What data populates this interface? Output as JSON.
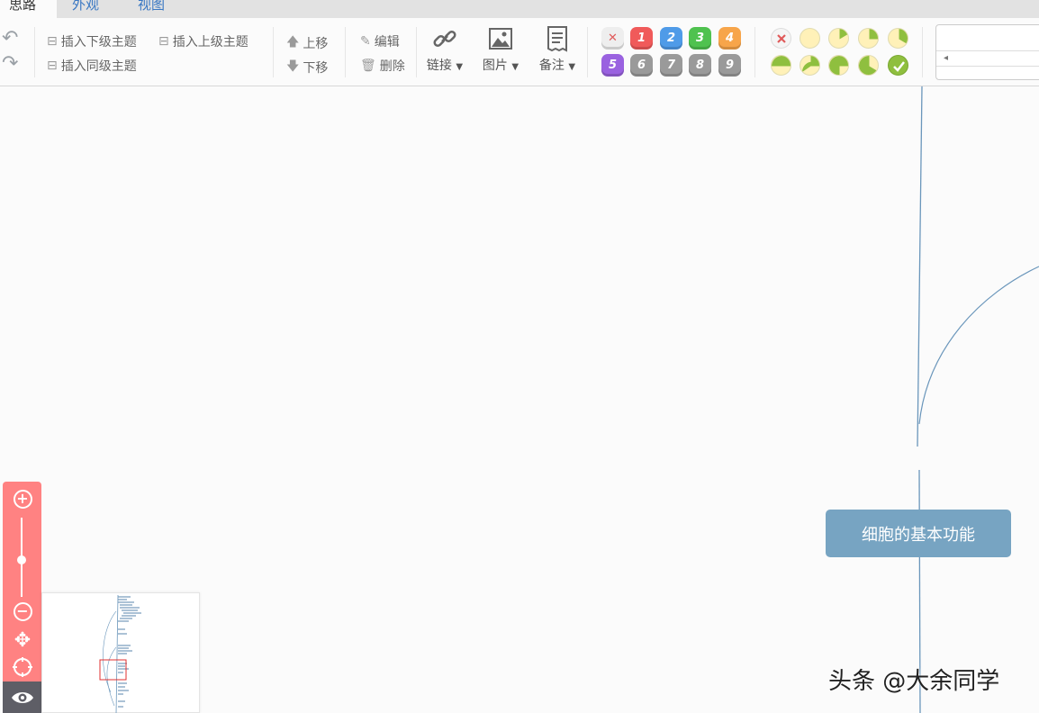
{
  "tabs": [
    {
      "label": "思路",
      "active": true
    },
    {
      "label": "外观",
      "active": false
    },
    {
      "label": "视图",
      "active": false
    }
  ],
  "toolbar": {
    "insert_child": "插入下级主题",
    "insert_parent": "插入上级主题",
    "insert_sibling": "插入同级主题",
    "move_up": "上移",
    "move_down": "下移",
    "edit": "编辑",
    "delete": "删除",
    "link": "链接",
    "image": "图片",
    "note": "备注",
    "priorities": [
      "1",
      "2",
      "3",
      "4",
      "5",
      "6",
      "7",
      "8",
      "9"
    ],
    "priority_colors": [
      "#f05a5a",
      "#4f9be8",
      "#4fc24f",
      "#f7a54a",
      "#9a62e0",
      "#9a9a9a",
      "#9a9a9a",
      "#9a9a9a",
      "#9a9a9a"
    ],
    "progress_levels": [
      0,
      1,
      2,
      3,
      4,
      5,
      6,
      7,
      8
    ]
  },
  "canvas": {
    "main_node": "细胞的基本功能"
  },
  "watermark": "头条 @大余同学",
  "colors": {
    "accent_blue": "#3a78c3",
    "node_fill": "#77a4c2",
    "zoom_panel": "#ff8282",
    "eye_bar": "#5e5e66"
  }
}
